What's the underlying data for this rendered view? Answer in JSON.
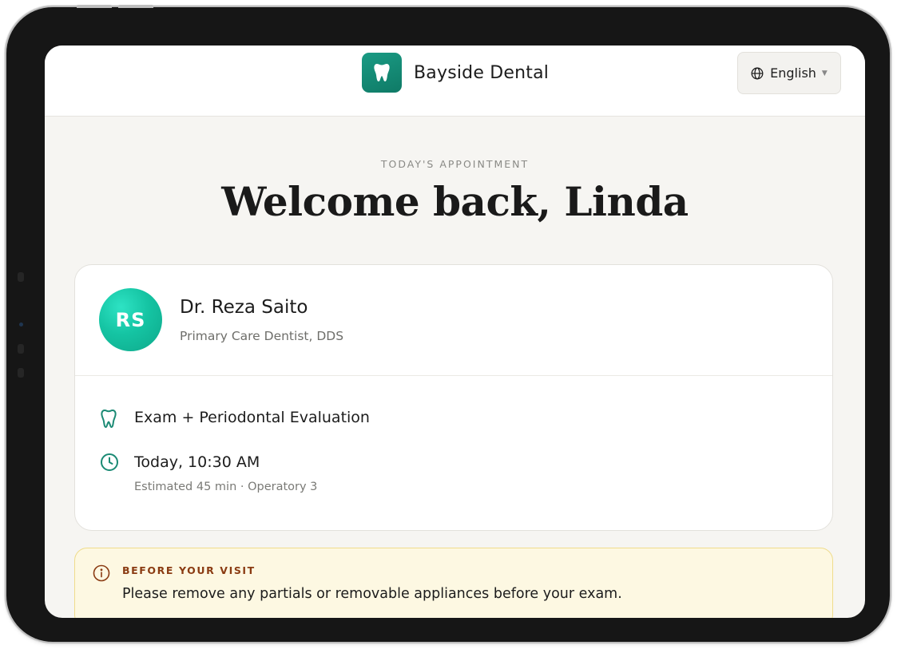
{
  "header": {
    "brand_name": "Bayside Dental",
    "brand_logo_icon": "tooth-icon",
    "language_label": "English",
    "language_icon": "globe-icon",
    "language_caret_icon": "caret-down-icon"
  },
  "hero": {
    "eyebrow": "TODAY'S APPOINTMENT",
    "title": "Welcome back, Linda"
  },
  "appointment": {
    "provider": {
      "initials": "RS",
      "name": "Dr. Reza Saito",
      "role": "Primary Care Dentist, DDS"
    },
    "service": {
      "icon": "tooth-icon",
      "label": "Exam + Periodontal Evaluation"
    },
    "time": {
      "icon": "clock-icon",
      "label": "Today, 10:30 AM",
      "detail": "Estimated 45 min · Operatory 3"
    }
  },
  "notice": {
    "icon": "info-icon",
    "title": "BEFORE YOUR VISIT",
    "text": "Please remove any partials or removable appliances before your exam."
  },
  "colors": {
    "brand_teal": "#0f7a66",
    "accent_teal": "#15c4a3",
    "icon_teal": "#1b8a74",
    "notice_bg": "#fdf8e2",
    "notice_title": "#8a3b12"
  }
}
